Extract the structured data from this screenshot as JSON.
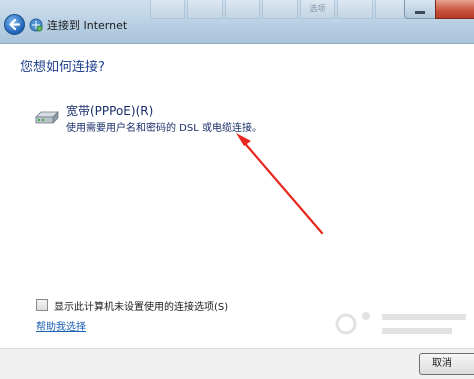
{
  "window": {
    "title": "连接到 Internet",
    "bg_tabs": [
      "",
      "",
      "",
      "",
      "选项",
      "",
      ""
    ]
  },
  "main": {
    "heading": "您想如何连接?",
    "option": {
      "title": "宽带(PPPoE)(R)",
      "description": "使用需要用户名和密码的 DSL 或电缆连接。",
      "icon": "modem-icon"
    }
  },
  "checkbox": {
    "label": "显示此计算机未设置使用的连接选项(S)",
    "checked": false
  },
  "help_link": "帮助我选择",
  "footer": {
    "cancel_label": "取消"
  },
  "colors": {
    "heading": "#1e3f8c",
    "link": "#1b5fb3",
    "arrow": "#e8281f"
  }
}
